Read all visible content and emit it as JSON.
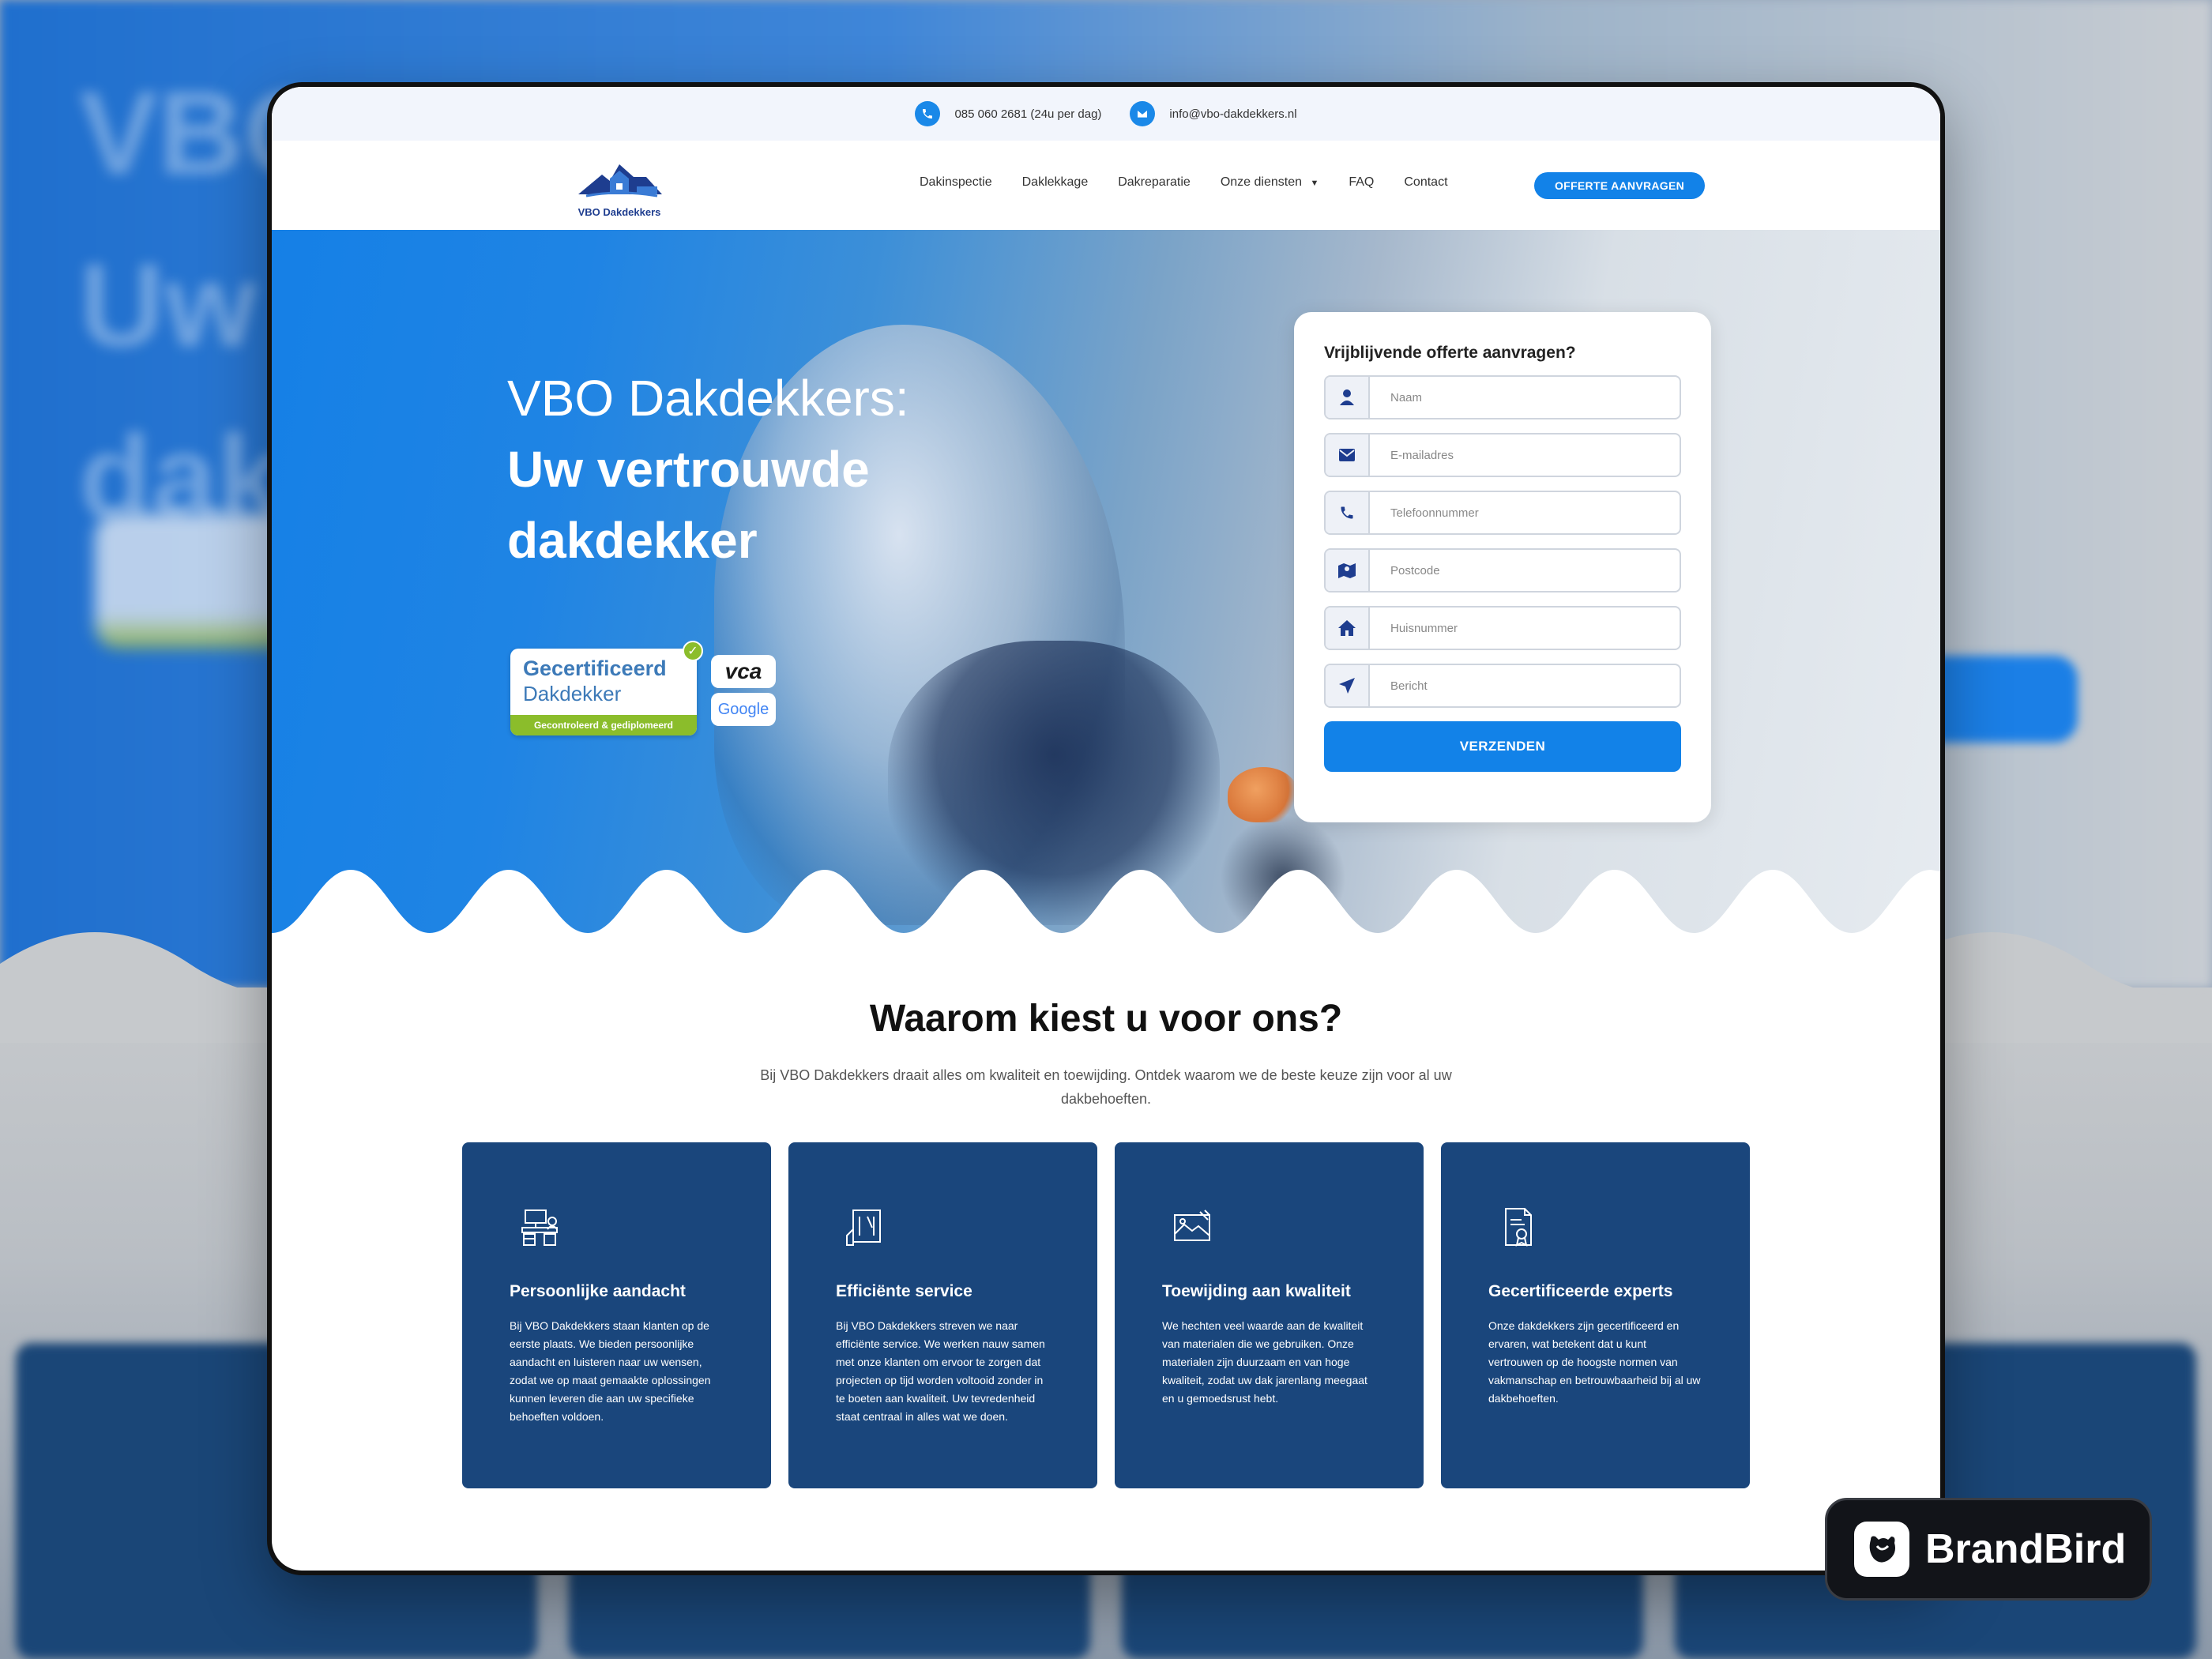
{
  "topbar": {
    "phone": "085 060 2681 (24u per dag)",
    "email": "info@vbo-dakdekkers.nl"
  },
  "header": {
    "logo_text": "VBO Dakdekkers",
    "nav": [
      {
        "label": "Dakinspectie"
      },
      {
        "label": "Daklekkage"
      },
      {
        "label": "Dakreparatie"
      },
      {
        "label": "Onze diensten"
      },
      {
        "label": "FAQ"
      },
      {
        "label": "Contact"
      }
    ],
    "cta": "OFFERTE AANVRAGEN"
  },
  "hero": {
    "title_line1": "VBO Dakdekkers:",
    "title_line2": "Uw vertrouwde",
    "title_line3": "dakdekker",
    "badge_cert_line1": "Gecertificeerd",
    "badge_cert_line2": "Dakdekker",
    "badge_cert_strip": "Gecontroleerd & gediplomeerd",
    "badge_vca": "vca",
    "badge_google": "Google"
  },
  "form": {
    "title": "Vrijblijvende offerte aanvragen?",
    "fields": [
      {
        "placeholder": "Naam",
        "icon": "user-icon"
      },
      {
        "placeholder": "E-mailadres",
        "icon": "envelope-icon"
      },
      {
        "placeholder": "Telefoonnummer",
        "icon": "phone-icon"
      },
      {
        "placeholder": "Postcode",
        "icon": "map-icon"
      },
      {
        "placeholder": "Huisnummer",
        "icon": "home-icon"
      },
      {
        "placeholder": "Bericht",
        "icon": "send-icon"
      }
    ],
    "submit": "VERZENDEN"
  },
  "why": {
    "title": "Waarom kiest u voor ons?",
    "intro": "Bij VBO Dakdekkers draait alles om kwaliteit en toewijding. Ontdek waarom we de beste keuze zijn voor al uw dakbehoeften.",
    "cards": [
      {
        "title": "Persoonlijke aandacht",
        "icon": "desk-icon",
        "text": "Bij VBO Dakdekkers staan klanten op de eerste plaats. We bieden persoonlijke aandacht en luisteren naar uw wensen, zodat we op maat gemaakte oplossingen kunnen leveren die aan uw specifieke behoeften voldoen."
      },
      {
        "title": "Efficiënte service",
        "icon": "tools-icon",
        "text": "Bij VBO Dakdekkers streven we naar efficiënte service. We werken nauw samen met onze klanten om ervoor te zorgen dat projecten op tijd worden voltooid zonder in te boeten aan kwaliteit. Uw tevredenheid staat centraal in alles wat we doen."
      },
      {
        "title": "Toewijding aan kwaliteit",
        "icon": "quality-icon",
        "text": "We hechten veel waarde aan de kwaliteit van materialen die we gebruiken. Onze materialen zijn duurzaam en van hoge kwaliteit, zodat uw dak jarenlang meegaat en u gemoedsrust hebt."
      },
      {
        "title": "Gecertificeerde experts",
        "icon": "certificate-icon",
        "text": "Onze dakdekkers zijn gecertificeerd en ervaren, wat betekent dat u kunt vertrouwen op de hoogste normen van vakmanschap en betrouwbaarheid bij al uw dakbehoeften."
      }
    ]
  },
  "watermark": {
    "label": "BrandBird"
  },
  "colors": {
    "primary": "#1282e8",
    "card": "#1a467c",
    "cert_green": "#8bbd2b"
  }
}
